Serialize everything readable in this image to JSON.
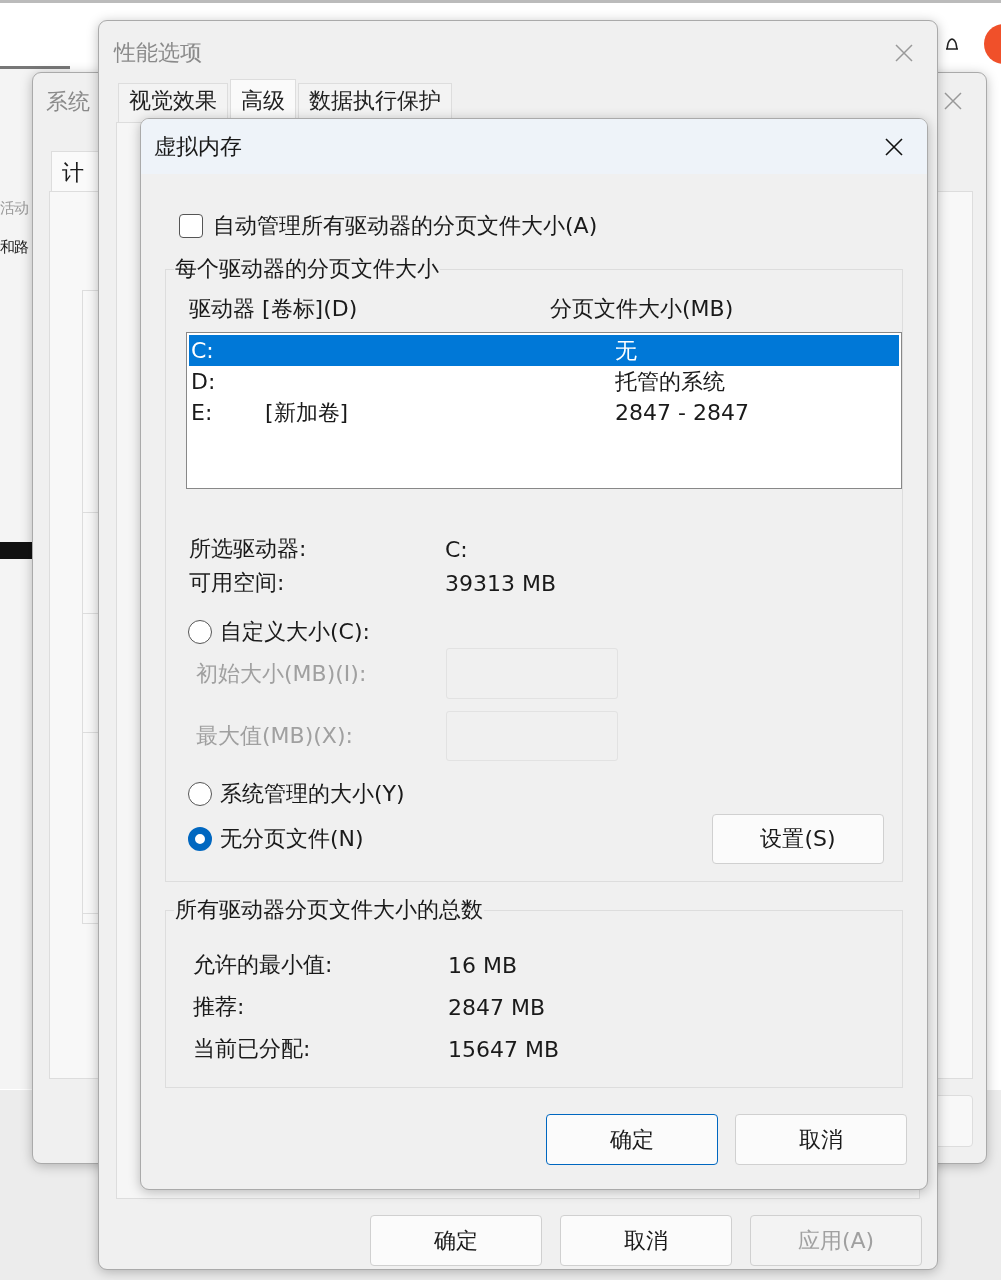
{
  "left_window": {
    "lines": [
      {
        "text": "活动",
        "disabled": true
      },
      {
        "text": "和路",
        "disabled": false
      }
    ]
  },
  "system_window": {
    "title": "系统",
    "tab": "计"
  },
  "performance_window": {
    "title": "性能选项",
    "tabs": [
      {
        "label": "视觉效果",
        "selected": false
      },
      {
        "label": "高级",
        "selected": true
      },
      {
        "label": "数据执行保护",
        "selected": false
      }
    ],
    "buttons": [
      {
        "label": "确定",
        "disabled": false
      },
      {
        "label": "取消",
        "disabled": false
      },
      {
        "label": "应用(A)",
        "disabled": true
      }
    ]
  },
  "virtual_memory_dialog": {
    "title": "虚拟内存",
    "auto_manage": {
      "label": "自动管理所有驱动器的分页文件大小(A)",
      "checked": false
    },
    "per_drive_group": {
      "title": "每个驱动器的分页文件大小",
      "columns": [
        "驱动器 [卷标](D)",
        "分页文件大小(MB)"
      ],
      "drives": [
        {
          "drive": "C:",
          "size": "无",
          "selected": true
        },
        {
          "drive": "D:",
          "size": "托管的系统",
          "selected": false
        },
        {
          "drive": "E:",
          "volume": "[新加卷]",
          "size": "2847 - 2847",
          "selected": false
        }
      ],
      "info": [
        {
          "label": "所选驱动器:",
          "value": "C:"
        },
        {
          "label": "可用空间:",
          "value": "39313 MB"
        }
      ],
      "radios": [
        {
          "label": "自定义大小(C):",
          "selected": false
        },
        {
          "label": "系统管理的大小(Y)",
          "selected": false
        },
        {
          "label": "无分页文件(N)",
          "selected": true
        }
      ],
      "size_fields": [
        {
          "label": "初始大小(MB)(I):",
          "disabled": true
        },
        {
          "label": "最大值(MB)(X):",
          "disabled": true
        }
      ],
      "set_button": "设置(S)"
    },
    "totals_group": {
      "title": "所有驱动器分页文件大小的总数",
      "rows": [
        {
          "label": "允许的最小值:",
          "value": "16 MB"
        },
        {
          "label": "推荐:",
          "value": "2847 MB"
        },
        {
          "label": "当前已分配:",
          "value": "15647 MB"
        }
      ]
    },
    "buttons": [
      {
        "label": "确定",
        "default": true
      },
      {
        "label": "取消",
        "default": false
      }
    ]
  }
}
